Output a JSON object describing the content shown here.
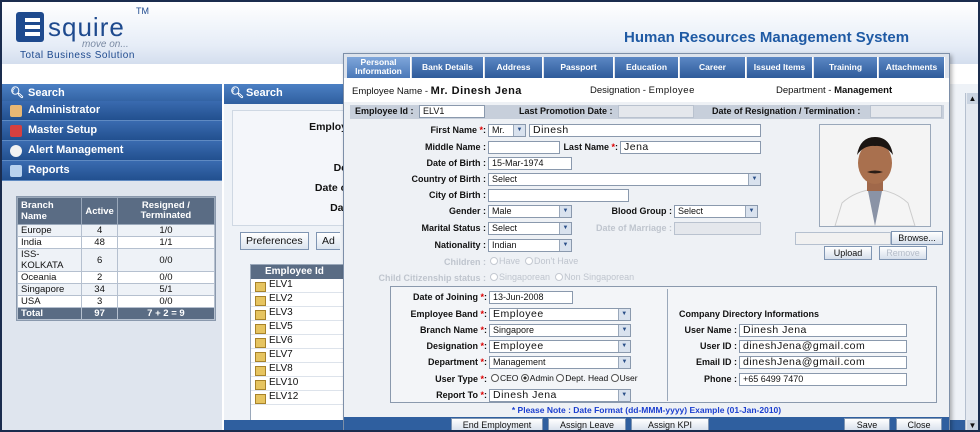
{
  "header": {
    "logo_text": "squire",
    "logo_tm": "TM",
    "logo_tagline": "move on...",
    "logo_sub": "Total Business Solution",
    "app_title": "Human Resources Management System"
  },
  "nav": {
    "search": "Search",
    "items": [
      {
        "label": "Administrator",
        "icon": "user-icon"
      },
      {
        "label": "Master Setup",
        "icon": "bookmark-icon"
      },
      {
        "label": "Alert Management",
        "icon": "alert-icon"
      },
      {
        "label": "Reports",
        "icon": "report-icon"
      }
    ],
    "branch_table": {
      "headers": [
        "Branch Name",
        "Active",
        "Resigned / Terminated"
      ],
      "rows": [
        [
          "Europe",
          "4",
          "1/0"
        ],
        [
          "India",
          "48",
          "1/1"
        ],
        [
          "ISS-KOLKATA",
          "6",
          "0/0"
        ],
        [
          "Oceania",
          "2",
          "0/0"
        ],
        [
          "Singapore",
          "34",
          "5/1"
        ],
        [
          "USA",
          "3",
          "0/0"
        ]
      ],
      "total": [
        "Total",
        "97",
        "7 + 2 = 9"
      ]
    }
  },
  "background": {
    "search": "Search",
    "labels": [
      "Employ",
      "De",
      "Date o",
      "Dat"
    ],
    "preferences": "Preferences",
    "add": "Ad",
    "list_header": "Employee Id",
    "employees": [
      "ELV1",
      "ELV2",
      "ELV3",
      "ELV5",
      "ELV6",
      "ELV7",
      "ELV8",
      "ELV10",
      "ELV12"
    ]
  },
  "dialog": {
    "tabs": [
      "Personal Information",
      "Bank Details",
      "Address",
      "Passport",
      "Education",
      "Career",
      "Issued Items",
      "Training",
      "Attachments"
    ],
    "info": {
      "name_label": "Employee Name -",
      "name": "Mr. Dinesh Jena",
      "designation_label": "Designation -",
      "designation": "Employee",
      "department_label": "Department -",
      "department": "Management"
    },
    "idbar": {
      "id_label": "Employee Id :",
      "id": "ELV1",
      "promo_label": "Last Promotion Date :",
      "resign_label": "Date of Resignation / Termination :"
    },
    "form": {
      "first_name_label": "First Name",
      "title": "Mr.",
      "first_name": "Dinesh",
      "middle_name_label": "Middle Name :",
      "last_name_label": "Last Name",
      "last_name": "Jena",
      "dob_label": "Date of Birth :",
      "dob": "15-Mar-1974",
      "country_label": "Country of Birth :",
      "country": "Select",
      "city_label": "City of Birth :",
      "gender_label": "Gender :",
      "gender": "Male",
      "blood_label": "Blood Group :",
      "blood": "Select",
      "marital_label": "Marital Status :",
      "marital": "Select",
      "marriage_label": "Date of Marriage :",
      "nationality_label": "Nationality :",
      "nationality": "Indian",
      "children_label": "Children :",
      "children_opts": [
        "Have",
        "Don't Have"
      ],
      "child_cit_label": "Child Citizenship status :",
      "child_cit_opts": [
        "Singaporean",
        "Non Singaporean"
      ]
    },
    "photo": {
      "browse": "Browse...",
      "upload": "Upload",
      "remove": "Remove"
    },
    "employment": {
      "join_label": "Date of Joining",
      "join": "13-Jun-2008",
      "band_label": "Employee Band",
      "band": "Employee",
      "branch_label": "Branch Name",
      "branch": "Singapore",
      "desig_label": "Designation",
      "desig": "Employee",
      "dept_label": "Department",
      "dept": "Management",
      "usertype_label": "User Type",
      "usertypes": [
        "CEO",
        "Admin",
        "Dept. Head",
        "User"
      ],
      "report_label": "Report To",
      "report": "Dinesh Jena"
    },
    "directory": {
      "title": "Company Directory Informations",
      "username_label": "User Name :",
      "username": "Dinesh Jena",
      "userid_label": "User ID :",
      "userid": "dineshJena@gmail.com",
      "email_label": "Email ID :",
      "email": "dineshJena@gmail.com",
      "phone_label": "Phone :",
      "phone": "+65 6499 7470"
    },
    "note": "* Please Note : Date Format (dd-MMM-yyyy) Example (01-Jan-2010)",
    "buttons": {
      "end": "End Employment",
      "assign_leave": "Assign Leave",
      "assign_kpi": "Assign KPI",
      "save": "Save",
      "close": "Close"
    }
  }
}
